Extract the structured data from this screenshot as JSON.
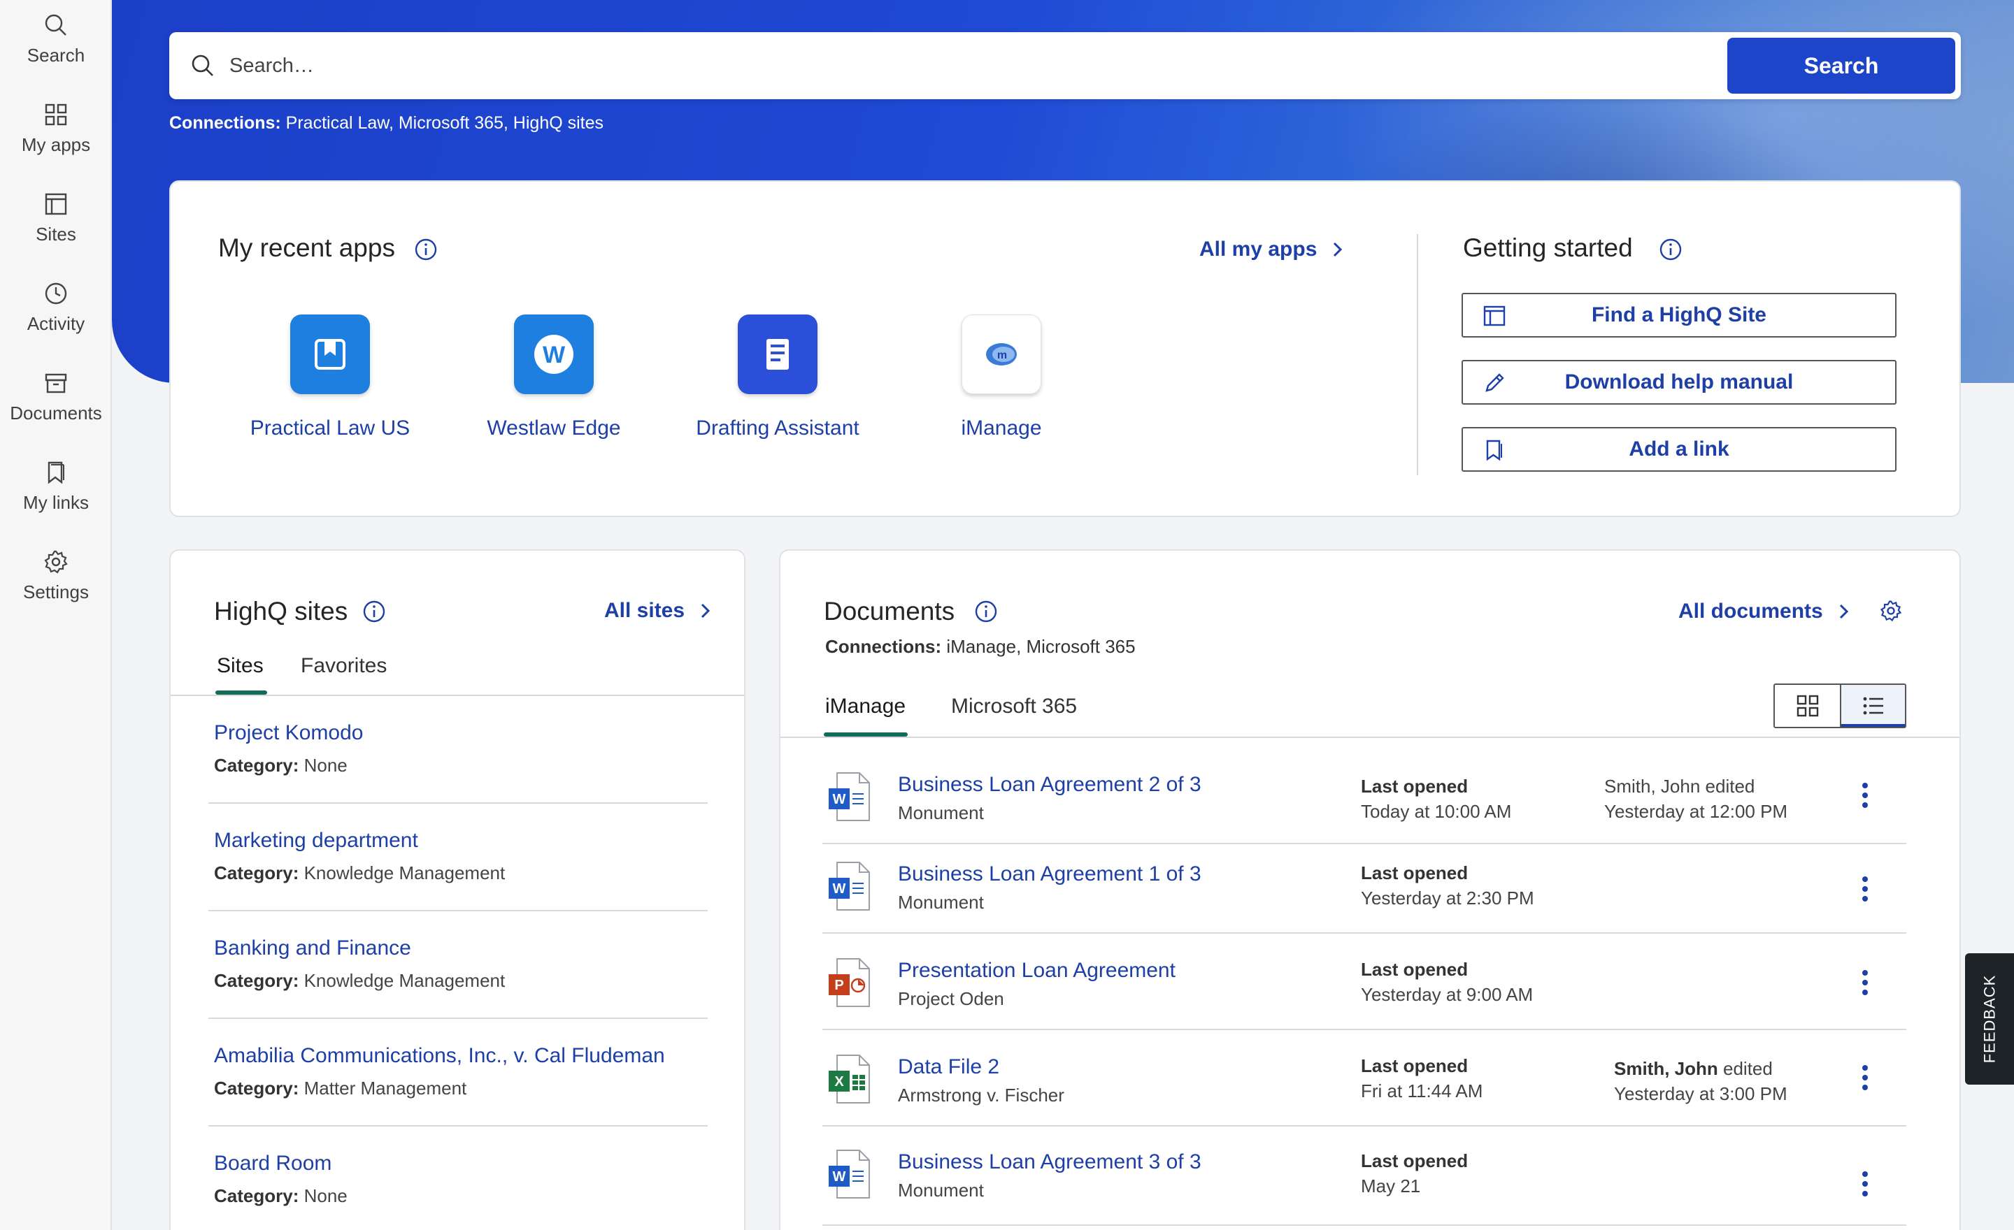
{
  "sidebar": {
    "items": [
      {
        "label": "Search",
        "icon": "search-icon"
      },
      {
        "label": "My apps",
        "icon": "grid-icon"
      },
      {
        "label": "Sites",
        "icon": "sites-icon"
      },
      {
        "label": "Activity",
        "icon": "clock-icon"
      },
      {
        "label": "Documents",
        "icon": "documents-icon"
      },
      {
        "label": "My links",
        "icon": "bookmark-icon"
      },
      {
        "label": "Settings",
        "icon": "gear-icon"
      }
    ]
  },
  "search": {
    "placeholder": "Search…",
    "button_label": "Search",
    "connections_label": "Connections:",
    "connections_value": "Practical Law, Microsoft 365, HighQ sites"
  },
  "recent_apps": {
    "title": "My recent apps",
    "all_link": "All my apps",
    "apps": [
      {
        "name": "Practical Law US",
        "color": "#1f7fe0"
      },
      {
        "name": "Westlaw Edge",
        "color": "#1f7fe0"
      },
      {
        "name": "Drafting Assistant",
        "color": "#2b4fd8"
      },
      {
        "name": "iManage",
        "color": "#ffffff"
      }
    ]
  },
  "getting_started": {
    "title": "Getting started",
    "buttons": [
      {
        "label": "Find a HighQ Site",
        "icon": "layout-icon"
      },
      {
        "label": "Download help manual",
        "icon": "pencil-icon"
      },
      {
        "label": "Add a link",
        "icon": "bookmark-icon"
      }
    ]
  },
  "highq_sites": {
    "title": "HighQ sites",
    "all_link": "All sites",
    "tabs": [
      "Sites",
      "Favorites"
    ],
    "category_label": "Category:",
    "sites": [
      {
        "name": "Project Komodo",
        "category": "None"
      },
      {
        "name": "Marketing department",
        "category": "Knowledge Management"
      },
      {
        "name": "Banking and Finance",
        "category": "Knowledge Management"
      },
      {
        "name": "Amabilia Communications, Inc., v. Cal Fludeman",
        "category": "Matter Management"
      },
      {
        "name": "Board Room",
        "category": "None"
      }
    ]
  },
  "documents": {
    "title": "Documents",
    "all_link": "All documents",
    "connections_label": "Connections:",
    "connections_value": "iManage, Microsoft 365",
    "tabs": [
      "iManage",
      "Microsoft 365"
    ],
    "last_opened_label": "Last opened",
    "items": [
      {
        "title": "Business Loan Agreement 2 of 3",
        "sub": "Monument",
        "type": "word",
        "last_opened": "Today at 10:00 AM",
        "editor": "Smith, John",
        "edited_suffix": "edited",
        "edited_when": "Yesterday at 12:00 PM"
      },
      {
        "title": "Business Loan Agreement 1 of 3",
        "sub": "Monument",
        "type": "word",
        "last_opened": "Yesterday at 2:30 PM",
        "editor": "",
        "edited_suffix": "",
        "edited_when": ""
      },
      {
        "title": "Presentation Loan Agreement",
        "sub": "Project Oden",
        "type": "powerpoint",
        "last_opened": "Yesterday at 9:00 AM",
        "editor": "",
        "edited_suffix": "",
        "edited_when": ""
      },
      {
        "title": "Data File 2",
        "sub": "Armstrong v. Fischer",
        "type": "excel",
        "last_opened": "Fri at 11:44 AM",
        "editor": "Smith, John",
        "edited_suffix": "edited",
        "edited_when": "Yesterday at 3:00 PM"
      },
      {
        "title": "Business Loan Agreement 3 of 3",
        "sub": "Monument",
        "type": "word",
        "last_opened": "May 21",
        "editor": "",
        "edited_suffix": "",
        "edited_when": ""
      }
    ]
  },
  "feedback": {
    "label": "FEEDBACK"
  },
  "colors": {
    "brand": "#1d45c9",
    "link": "#1d3fa6",
    "tab_underline": "#116a5a"
  }
}
